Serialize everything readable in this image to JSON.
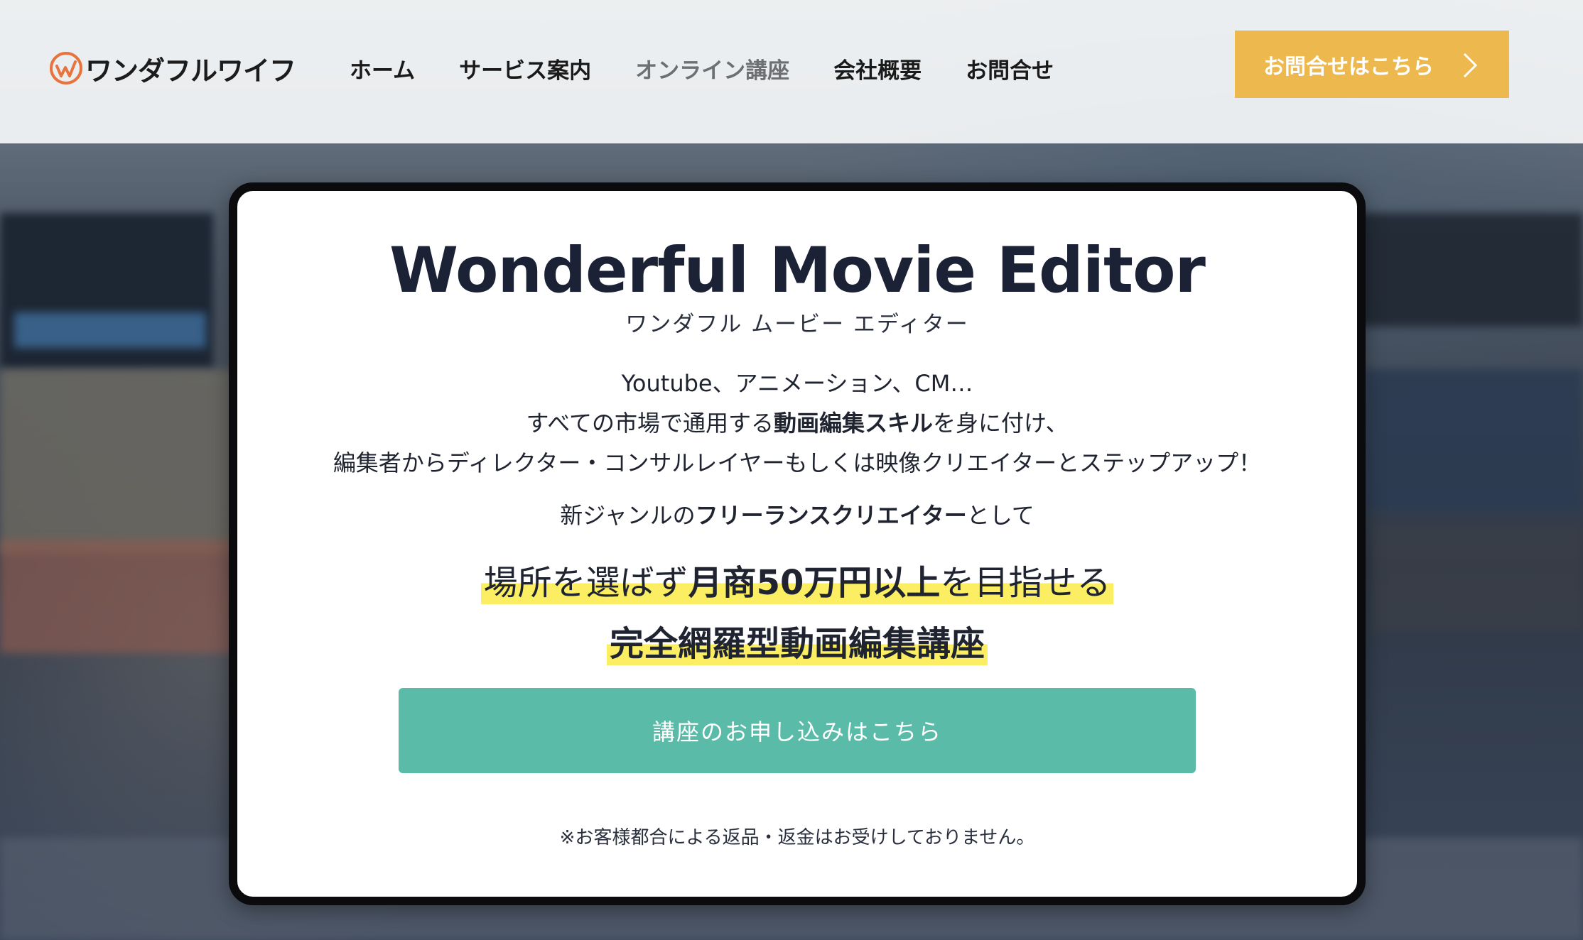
{
  "header": {
    "logo_text": "ワンダフルワイフ",
    "nav": [
      {
        "label": "ホーム"
      },
      {
        "label": "サービス案内"
      },
      {
        "label": "オンライン講座"
      },
      {
        "label": "会社概要"
      },
      {
        "label": "お問合せ"
      }
    ],
    "cta_label": "お問合せはこちら",
    "cta_icon": "chevron-right-icon"
  },
  "hero": {
    "title": "Wonderful Movie Editor",
    "subtitle": "ワンダフル ムービー エディター",
    "desc_line1": "Youtube、アニメーション、CM…",
    "desc_line2_pre": "すべての市場で通用する",
    "desc_line2_bold": "動画編集スキル",
    "desc_line2_post": "を身に付け、",
    "desc_line3": "編集者からディレクター・コンサルレイヤーもしくは映像クリエイターとステップアップ！",
    "mid_pre": "新ジャンルの",
    "mid_bold": "フリーランスクリエイター",
    "mid_post": "として",
    "headline1_pre": "場所を選ばず",
    "headline1_bold": "月商50万円以上",
    "headline1_post": "を目指せる",
    "headline2": "完全網羅型動画編集講座",
    "apply_button": "講座のお申し込みはこちら",
    "note": "※お客様都合による返品・返金はお受けしておりません。"
  },
  "colors": {
    "cta_yellow": "#edb94e",
    "apply_green": "#5abba8",
    "highlight": "#fbee62",
    "logo_orange": "#e8733d",
    "text_dark": "#1c2236"
  }
}
